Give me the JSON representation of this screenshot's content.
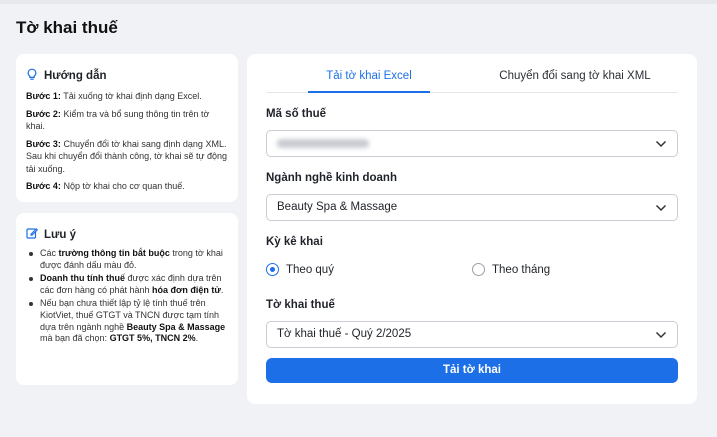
{
  "page": {
    "title": "Tờ khai thuế"
  },
  "guide": {
    "title": "Hướng dẫn",
    "steps": [
      {
        "label": "Bước 1:",
        "text": " Tải xuống tờ khai định dạng Excel."
      },
      {
        "label": "Bước 2:",
        "text": " Kiểm tra và bổ sung thông tin trên tờ khai."
      },
      {
        "label": "Bước 3:",
        "text": " Chuyển đổi tờ khai sang định dạng XML. Sau khi chuyển đổi thành công, tờ khai sẽ tự động tải xuống."
      },
      {
        "label": "Bước 4:",
        "text": " Nộp tờ khai cho cơ quan thuế."
      }
    ]
  },
  "note": {
    "title": "Lưu ý",
    "item1": {
      "a": "Các ",
      "b": "trường thông tin bắt buộc",
      "c": " trong tờ khai được đánh dấu màu đỏ."
    },
    "item2": {
      "a": "Doanh thu tính thuế",
      "b": " được xác định dựa trên các đơn hàng có phát hành ",
      "c": "hóa đơn điện tử",
      "d": "."
    },
    "item3": {
      "a": "Nếu bạn chưa thiết lập tỷ lệ tính thuế trên KiotViet, thuế GTGT và TNCN được tạm tính dựa trên ngành nghề ",
      "b": "Beauty Spa & Massage",
      "c": " mà bạn đã chọn: ",
      "d": "GTGT 5%, TNCN 2%",
      "e": "."
    }
  },
  "tabs": {
    "excel": "Tải tờ khai Excel",
    "xml": "Chuyển đổi sang tờ khai XML"
  },
  "form": {
    "tax_code_label": "Mã số thuế",
    "industry_label": "Ngành nghề kinh doanh",
    "industry_value": "Beauty Spa & Massage",
    "period_label": "Kỳ kê khai",
    "period_quarter": "Theo quý",
    "period_month": "Theo tháng",
    "declaration_label": "Tờ khai thuế",
    "declaration_value": "Tờ khai thuế - Quý 2/2025",
    "download_button": "Tải tờ khai"
  },
  "colors": {
    "accent": "#1d6fe8"
  }
}
